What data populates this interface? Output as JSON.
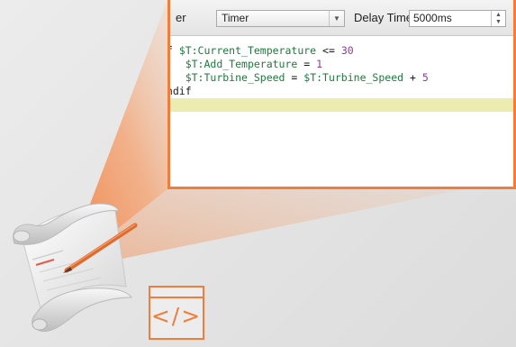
{
  "toolbar": {
    "trigger_label": "er",
    "trigger_value": "Timer",
    "delay_label": "Delay Time",
    "delay_value": "5000ms"
  },
  "code": {
    "lines": [
      {
        "indent": "",
        "parts": [
          {
            "t": "if ",
            "c": "kw"
          },
          {
            "t": "$T:Current_Temperature",
            "c": "var"
          },
          {
            "t": " <= ",
            "c": "op"
          },
          {
            "t": "30",
            "c": "num"
          }
        ]
      },
      {
        "indent": "    ",
        "parts": [
          {
            "t": "$T:Add_Temperature",
            "c": "var"
          },
          {
            "t": " = ",
            "c": "op"
          },
          {
            "t": "1",
            "c": "num"
          }
        ]
      },
      {
        "indent": "    ",
        "parts": [
          {
            "t": "$T:Turbine_Speed",
            "c": "var"
          },
          {
            "t": " = ",
            "c": "op"
          },
          {
            "t": "$T:Turbine_Speed",
            "c": "var"
          },
          {
            "t": " + ",
            "c": "op"
          },
          {
            "t": "5",
            "c": "num"
          }
        ]
      },
      {
        "indent": "",
        "parts": [
          {
            "t": "endif",
            "c": "kw"
          }
        ]
      },
      {
        "indent": "",
        "parts": [],
        "highlight": true
      }
    ]
  },
  "code_icon": {
    "glyph": "</>"
  },
  "colors": {
    "accent": "#f07d3c",
    "highlight": "#ecebb0",
    "variable": "#1f7a3d",
    "number": "#8f3aa8"
  },
  "icons": [
    "script-scroll-icon",
    "pencil-icon",
    "code-window-icon",
    "dropdown-arrow-icon",
    "spinner-arrows-icon"
  ]
}
